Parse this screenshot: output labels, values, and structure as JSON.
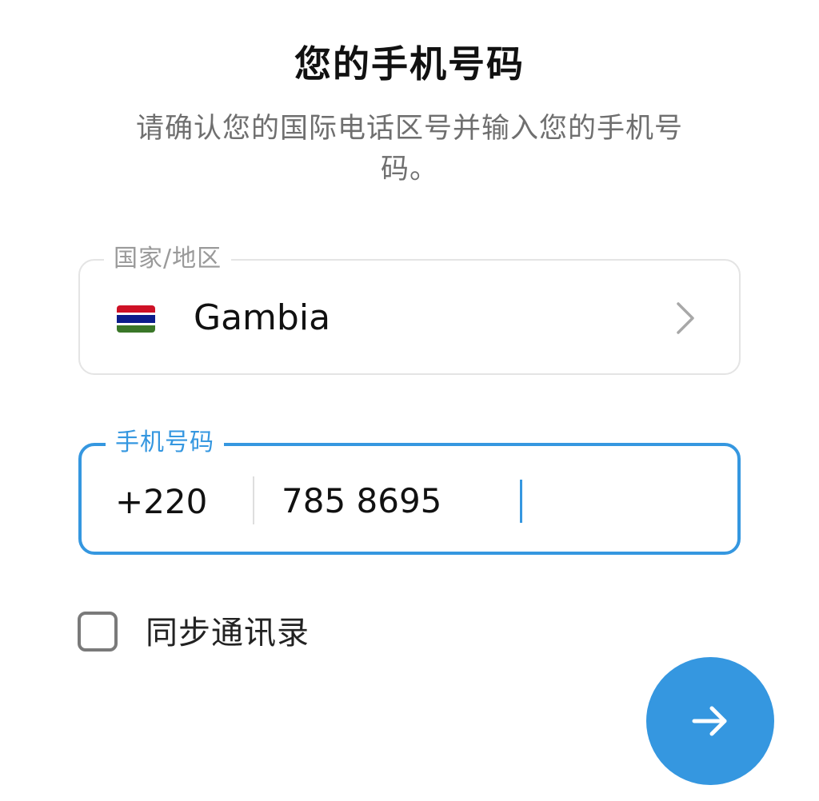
{
  "header": {
    "title": "您的手机号码",
    "subtitle": "请确认您的国际电话区号并输入您的手机号码。"
  },
  "country_field": {
    "label": "国家/地区",
    "country_name": "Gambia",
    "flag_icon": "gambia-flag-icon",
    "flag_colors": [
      "#ce1126",
      "#0c1c8c",
      "#3a7728"
    ],
    "chevron_icon": "chevron-right-icon"
  },
  "phone_field": {
    "label": "手机号码",
    "country_code": "+220",
    "number": "785 8695"
  },
  "sync_contacts": {
    "label": "同步通讯录",
    "checked": false
  },
  "next_button": {
    "icon": "arrow-right-icon"
  },
  "colors": {
    "accent": "#3597e0",
    "border": "#e4e4e4",
    "label_gray": "#9a9a9a",
    "subtitle_gray": "#6f6f6f"
  }
}
